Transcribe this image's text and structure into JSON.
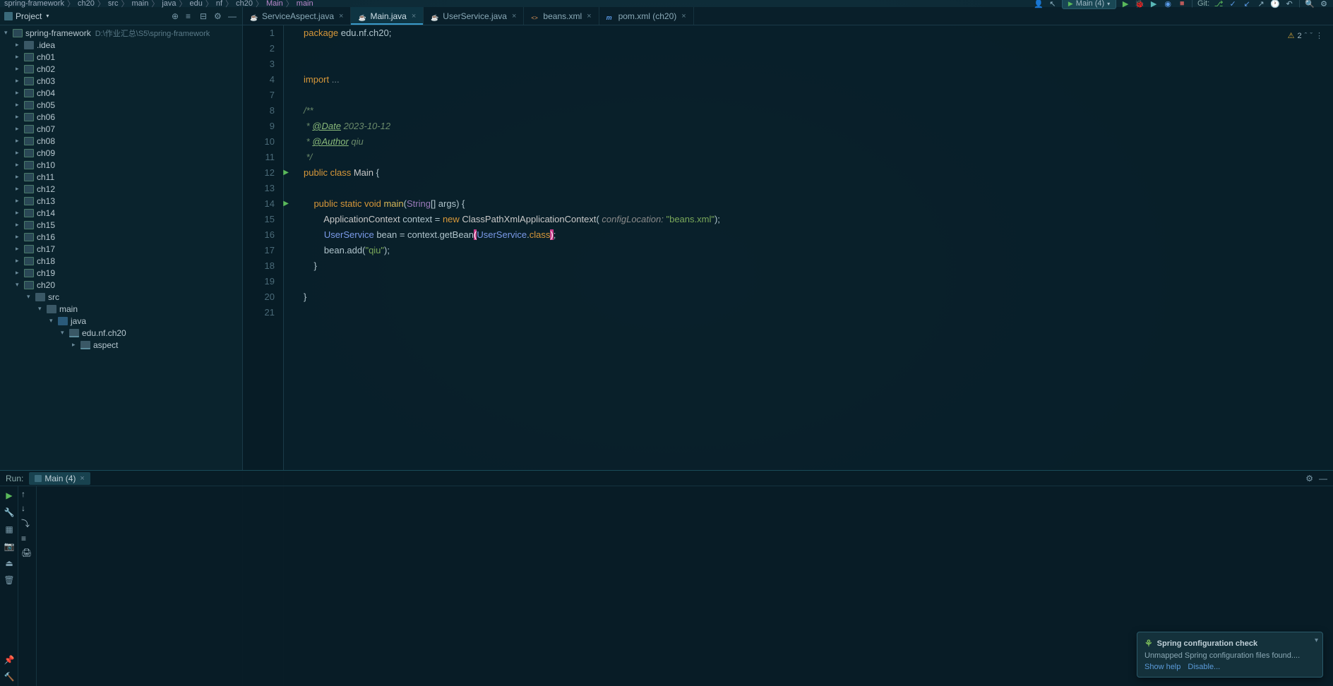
{
  "breadcrumb": [
    "spring-framework",
    "ch20",
    "src",
    "main",
    "java",
    "edu",
    "nf",
    "ch20",
    "Main",
    "main"
  ],
  "run_config": "Main (4)",
  "git_label": "Git:",
  "project_tool": {
    "title": "Project",
    "root": {
      "name": "spring-framework",
      "path": "D:\\作业汇总\\S5\\spring-framework"
    },
    "children": [
      ".idea",
      "ch01",
      "ch02",
      "ch03",
      "ch04",
      "ch05",
      "ch06",
      "ch07",
      "ch08",
      "ch09",
      "ch10",
      "ch11",
      "ch12",
      "ch13",
      "ch14",
      "ch15",
      "ch16",
      "ch17",
      "ch18",
      "ch19",
      "ch20"
    ],
    "ch20_tree": {
      "src": "src",
      "main": "main",
      "java": "java",
      "pkg": "edu.nf.ch20",
      "aspect": "aspect"
    }
  },
  "tabs": [
    {
      "name": "ServiceAspect.java",
      "icon": "java"
    },
    {
      "name": "Main.java",
      "icon": "java",
      "active": true
    },
    {
      "name": "UserService.java",
      "icon": "java"
    },
    {
      "name": "beans.xml",
      "icon": "xml"
    },
    {
      "name": "pom.xml (ch20)",
      "icon": "maven"
    }
  ],
  "code_warnings": "2",
  "code": {
    "l1_kw": "package",
    "l1_rest": " edu.nf.ch20;",
    "l4_kw": "import ",
    "l4_fold": "...",
    "l8": "/**",
    "l9_star": " * ",
    "l9_tag": "@Date",
    "l9_val": " 2023-10-12",
    "l10_star": " * ",
    "l10_tag": "@Author",
    "l10_val": " qiu",
    "l11": " */",
    "l12_pub": "public class ",
    "l12_cls": "Main ",
    "l12_brace": "{",
    "l14_mods": "    public static void ",
    "l14_main": "main",
    "l14_p1": "(",
    "l14_str": "String",
    "l14_arr": "[] args) {",
    "l15_ind": "        ",
    "l15_ac": "ApplicationContext",
    "l15_mid": " context = ",
    "l15_new": "new ",
    "l15_cp": "ClassPathXmlApplicationContext",
    "l15_p": "( ",
    "l15_param": "configLocation:",
    "l15_str": " \"beans.xml\"",
    "l15_end": ");",
    "l16_ind": "        ",
    "l16_us": "UserService",
    "l16_mid": " bean = context.getBean",
    "l16_hl1": "(",
    "l16_hl2": "UserService",
    "l16_dot": ".",
    "l16_cls": "class",
    "l16_hl3": ")",
    "l16_end": ";",
    "l17": "        bean.add(",
    "l17_str": "\"qiu\"",
    "l17_end": ");",
    "l18": "    }",
    "l20": "}"
  },
  "run_panel": {
    "label": "Run:",
    "tab": "Main (4)"
  },
  "notification": {
    "title": "Spring configuration check",
    "body": "Unmapped Spring configuration files found....",
    "show_help": "Show help",
    "disable": "Disable..."
  }
}
